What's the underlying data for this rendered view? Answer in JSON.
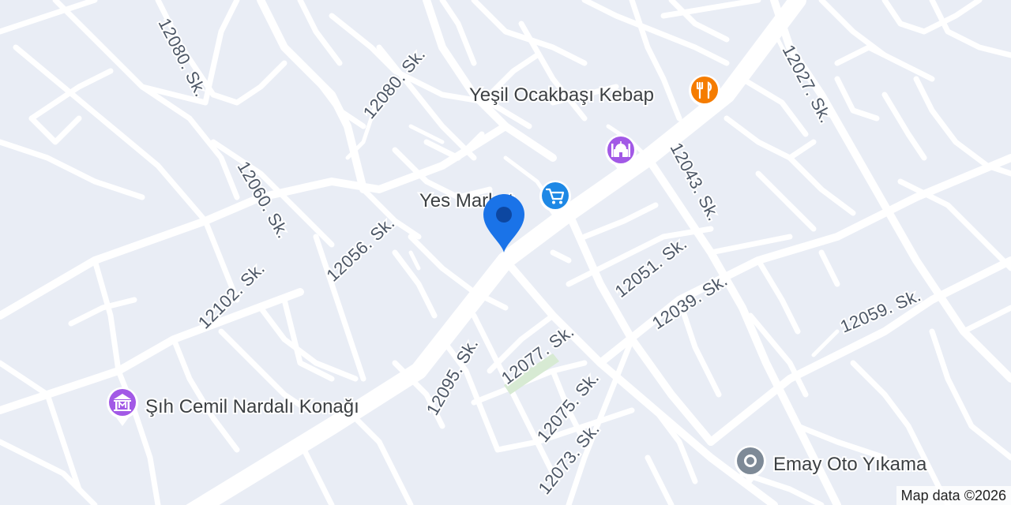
{
  "streets": [
    {
      "id": "s1",
      "label": "12080. Sk."
    },
    {
      "id": "s2",
      "label": "12080. Sk."
    },
    {
      "id": "s3",
      "label": "12060. Sk."
    },
    {
      "id": "s4",
      "label": "12056. Sk."
    },
    {
      "id": "s5",
      "label": "12102. Sk."
    },
    {
      "id": "s6",
      "label": "12027. Sk."
    },
    {
      "id": "s7",
      "label": "12043. Sk."
    },
    {
      "id": "s8",
      "label": "12051. Sk."
    },
    {
      "id": "s9",
      "label": "12039. Sk."
    },
    {
      "id": "s10",
      "label": "12059. Sk."
    },
    {
      "id": "s11",
      "label": "12077. Sk."
    },
    {
      "id": "s12",
      "label": "12095. Sk."
    },
    {
      "id": "s13",
      "label": "12075. Sk."
    },
    {
      "id": "s14",
      "label": "12073. Sk."
    }
  ],
  "pois": [
    {
      "id": "kebap",
      "label": "Yeşil Ocakbaşı Kebap",
      "icon": "restaurant-icon",
      "color": "#f57c00"
    },
    {
      "id": "market",
      "label": "Yes Market",
      "icon": "shopping-cart-icon",
      "color": "#1e88e5"
    },
    {
      "id": "mosque",
      "label": "",
      "icon": "mosque-icon",
      "color": "#a259e6"
    },
    {
      "id": "konak",
      "label": "Şıh Cemil Nardalı Konağı",
      "icon": "museum-icon",
      "color": "#a259e6"
    },
    {
      "id": "oto",
      "label": "Emay Oto Yıkama",
      "icon": "place-pin-icon",
      "color": "#7e8a97"
    }
  ],
  "location_pin": {
    "icon": "location-pin-icon",
    "color": "#1a73e8"
  },
  "attribution": "Map data ©2026",
  "colors": {
    "background": "#e9edf5",
    "road": "#ffffff",
    "label": "#4d5766",
    "park": "#d7ead3"
  }
}
